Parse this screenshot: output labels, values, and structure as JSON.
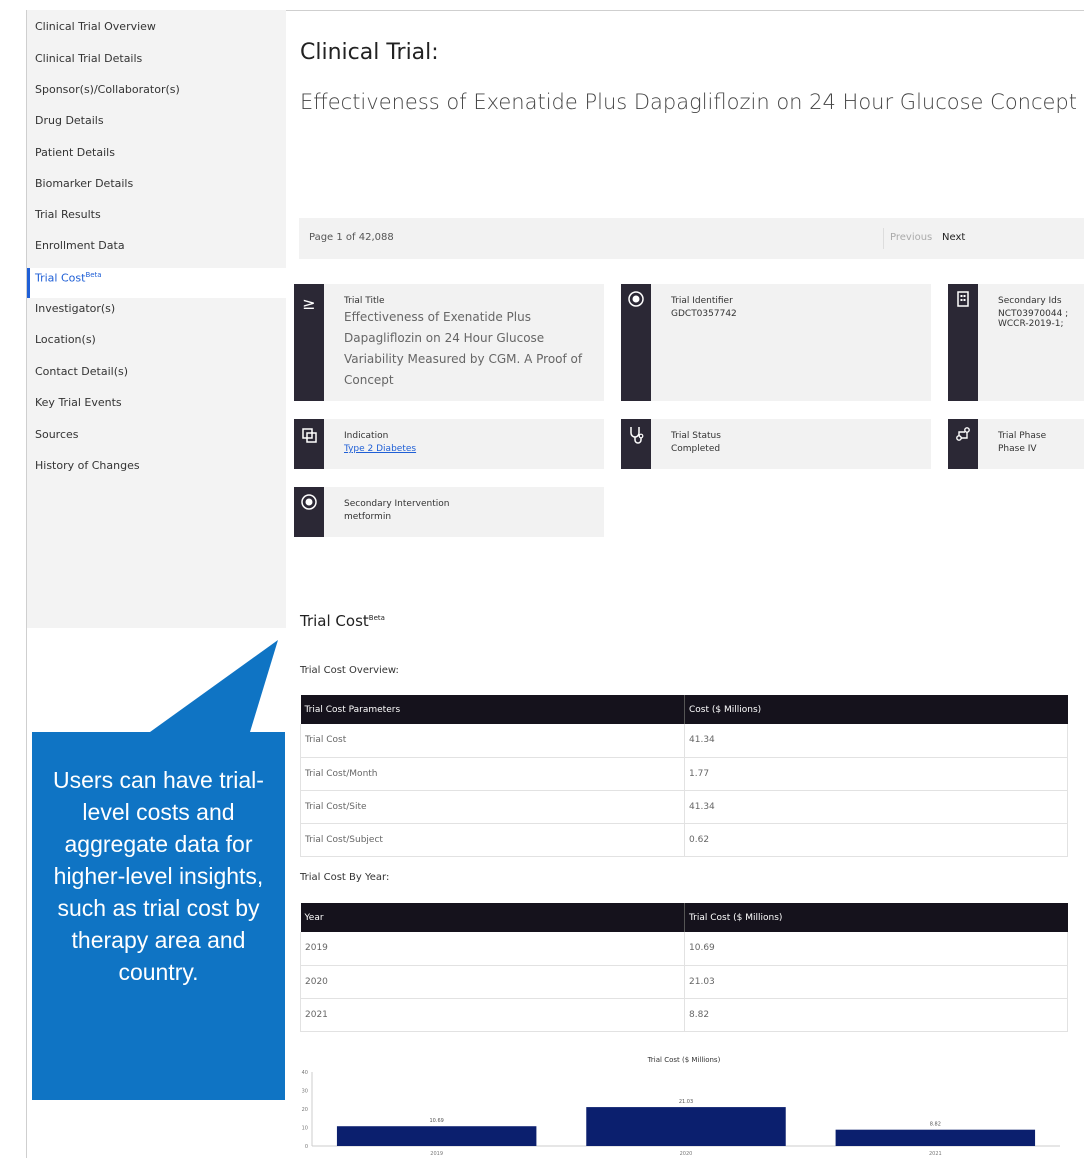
{
  "sidebar": {
    "items": [
      {
        "label": "Clinical Trial Overview"
      },
      {
        "label": "Clinical Trial Details"
      },
      {
        "label": "Sponsor(s)/Collaborator(s)"
      },
      {
        "label": "Drug Details"
      },
      {
        "label": "Patient Details"
      },
      {
        "label": "Biomarker Details"
      },
      {
        "label": "Trial Results"
      },
      {
        "label": "Enrollment Data"
      },
      {
        "label": "Trial Cost",
        "sup": "Beta"
      },
      {
        "label": "Investigator(s)"
      },
      {
        "label": "Location(s)"
      },
      {
        "label": "Contact Detail(s)"
      },
      {
        "label": "Key Trial Events"
      },
      {
        "label": "Sources"
      },
      {
        "label": "History of Changes"
      }
    ],
    "active_index": 8
  },
  "header": {
    "label": "Clinical Trial:",
    "title": "Effectiveness of Exenatide Plus Dapagliflozin on 24 Hour Glucose Concept"
  },
  "pager": {
    "text": "Page  1  of 42,088",
    "previous": "Previous",
    "next": "Next"
  },
  "cards": {
    "trial_title": {
      "label": "Trial Title",
      "value": "Effectiveness of Exenatide Plus Dapagliflozin on 24 Hour Glucose Variability Measured by CGM. A Proof of Concept",
      "icon": ">"
    },
    "trial_identifier": {
      "label": "Trial Identifier",
      "value": "GDCT0357742",
      "icon": "target"
    },
    "secondary_ids": {
      "label": "Secondary Ids",
      "value": "NCT03970044 ; WCCR-2019-1;",
      "icon": "building"
    },
    "indication": {
      "label": "Indication",
      "value": "Type 2 Diabetes",
      "icon": "indication"
    },
    "trial_status": {
      "label": "Trial Status",
      "value": "Completed",
      "icon": "stethoscope"
    },
    "trial_phase": {
      "label": "Trial Phase",
      "value": "Phase IV",
      "icon": "phase"
    },
    "secondary_intervention": {
      "label": "Secondary Intervention",
      "value": "metformin",
      "icon": "target"
    }
  },
  "trial_cost": {
    "title": "Trial Cost",
    "title_sup": "Beta",
    "overview_label": "Trial Cost Overview:",
    "overview_headers": [
      "Trial Cost Parameters",
      "Cost ($ Millions)"
    ],
    "overview_rows": [
      [
        "Trial Cost",
        "41.34"
      ],
      [
        "Trial Cost/Month",
        "1.77"
      ],
      [
        "Trial Cost/Site",
        "41.34"
      ],
      [
        "Trial Cost/Subject",
        "0.62"
      ]
    ],
    "by_year_label": "Trial Cost By Year:",
    "by_year_headers": [
      "Year",
      "Trial Cost ($ Millions)"
    ],
    "by_year_rows": [
      [
        "2019",
        "10.69"
      ],
      [
        "2020",
        "21.03"
      ],
      [
        "2021",
        "8.82"
      ]
    ]
  },
  "chart_data": {
    "type": "bar",
    "title": "Trial Cost ($ Millions)",
    "categories": [
      "2019",
      "2020",
      "2021"
    ],
    "values": [
      10.69,
      21.03,
      8.82
    ],
    "ylim": [
      0,
      40
    ],
    "yticks": [
      0,
      10,
      20,
      30,
      40
    ],
    "bar_color": "#0b1f6e"
  },
  "callout": {
    "text": "Users can have trial-level costs and aggregate data for higher-level insights, such as trial cost by therapy area and country.",
    "color": "#0f74c4"
  }
}
